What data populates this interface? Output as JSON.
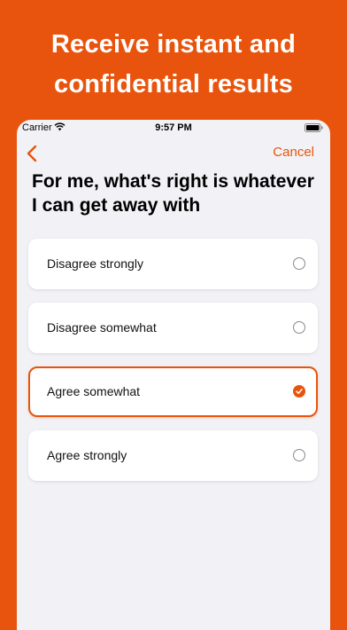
{
  "headline": {
    "line1": "Receive instant and",
    "line2": "confidential results"
  },
  "status_bar": {
    "carrier": "Carrier",
    "time": "9:57 PM"
  },
  "nav": {
    "back_icon": "chevron-left-icon",
    "cancel_label": "Cancel"
  },
  "question": "For me, what's right is whatever I can get away with",
  "options": [
    {
      "label": "Disagree strongly",
      "selected": false
    },
    {
      "label": "Disagree somewhat",
      "selected": false
    },
    {
      "label": "Agree somewhat",
      "selected": true
    },
    {
      "label": "Agree strongly",
      "selected": false
    }
  ],
  "colors": {
    "accent": "#E8540D",
    "background": "#F2F2F6",
    "card": "#FFFFFF"
  }
}
